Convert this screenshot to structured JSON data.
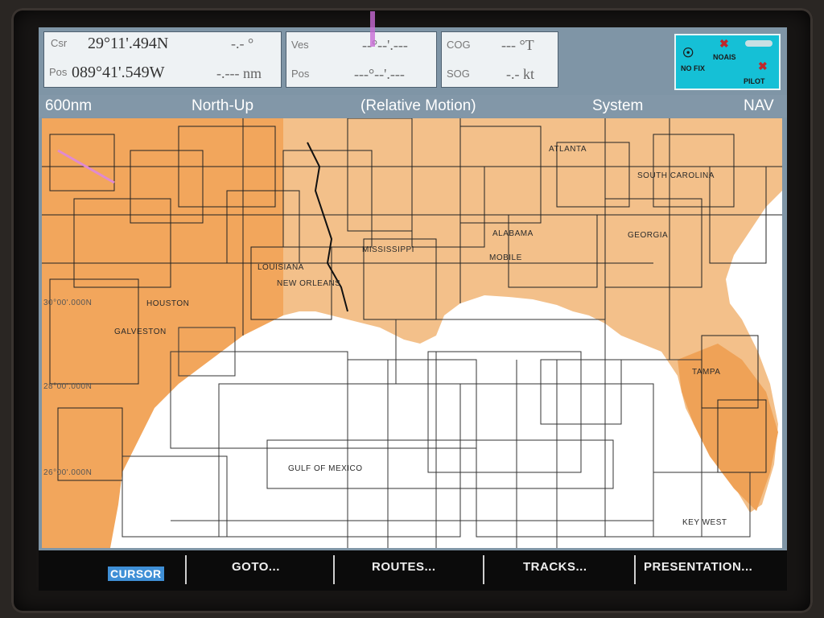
{
  "top_panel": {
    "csr": {
      "label": "Csr",
      "lat": "29°11'.494N",
      "value": "-.- °"
    },
    "pos": {
      "label": "Pos",
      "lon": "089°41'.549W",
      "value": "-.--- nm"
    },
    "ves": {
      "label": "Ves",
      "value": "--°--'.---"
    },
    "vpos": {
      "label": "Pos",
      "value": "---°--'.---"
    },
    "cog": {
      "label": "COG",
      "value": "--- °T"
    },
    "sog": {
      "label": "SOG",
      "value": "-.- kt"
    },
    "status": {
      "no_fix": "NO FIX",
      "no_ais": "NOAIS",
      "pilot": "PILOT"
    }
  },
  "header": {
    "range": "600nm",
    "orientation": "North-Up",
    "motion": "(Relative Motion)",
    "system": "System",
    "mode": "NAV"
  },
  "map": {
    "labels": {
      "atlanta": "ATLANTA",
      "south_carolina": "SOUTH CAROLINA",
      "alabama": "ALABAMA",
      "georgia": "GEORGIA",
      "mississippi": "MISSISSIPPI",
      "mobile": "MOBILE",
      "louisiana": "LOUISIANA",
      "new_orleans": "NEW ORLEANS",
      "galveston": "GALVESTON",
      "houston": "HOUSTON",
      "gulf_of_mexico": "GULF OF MEXICO",
      "key_west": "KEY WEST",
      "tampa": "TAMPA",
      "lat_30": "30°00'.000N",
      "lat_28": "28°00'.000N",
      "lat_26": "26°00'.000N"
    },
    "colors": {
      "land": "#f0b87c",
      "land_west": "#f0a050",
      "water": "#ffffff",
      "grid": "#1a1a1a"
    }
  },
  "softkeys": {
    "cursor": "CURSOR",
    "goto": "GOTO...",
    "routes": "ROUTES...",
    "tracks": "TRACKS...",
    "presentation": "PRESENTATION..."
  }
}
